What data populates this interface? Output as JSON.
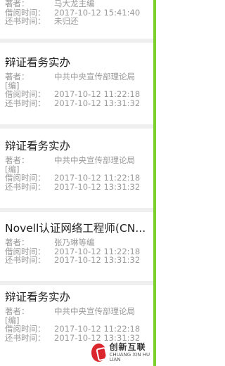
{
  "labels": {
    "author": "著者：",
    "borrow_time": "借阅时间：",
    "return_time": "还书时间："
  },
  "records": [
    {
      "title": "",
      "author": "马大龙主编",
      "author_cont": "",
      "borrow_time": "2017-10-12 15:41:40",
      "return_time": "未归还"
    },
    {
      "title": "辩证看务实办",
      "author": "中共中央宣传部理论局",
      "author_cont": "[编]",
      "borrow_time": "2017-10-12 11:22:18",
      "return_time": "2017-10-12 13:31:32"
    },
    {
      "title": "辩证看务实办",
      "author": "中共中央宣传部理论局",
      "author_cont": "[编]",
      "borrow_time": "2017-10-12 11:22:18",
      "return_time": "2017-10-12 13:31:32"
    },
    {
      "title": "Novell认证网络工程师(CN...",
      "author": "张乃琳等编",
      "author_cont": "",
      "borrow_time": "2017-10-12 11:22:18",
      "return_time": "2017-10-12 13:31:32"
    },
    {
      "title": "辩证看务实办",
      "author": "中共中央宣传部理论局",
      "author_cont": "[编]",
      "borrow_time": "2017-10-12 11:22:18",
      "return_time": "2017-10-12 13:31:32"
    }
  ],
  "watermark": {
    "cn": "创新互联",
    "en": "CHUANG XIN HU LIAN"
  },
  "colors": {
    "accent_bar": "#7ccf2c",
    "divider": "#efefef",
    "title_text": "#222222",
    "meta_text": "#999999"
  }
}
